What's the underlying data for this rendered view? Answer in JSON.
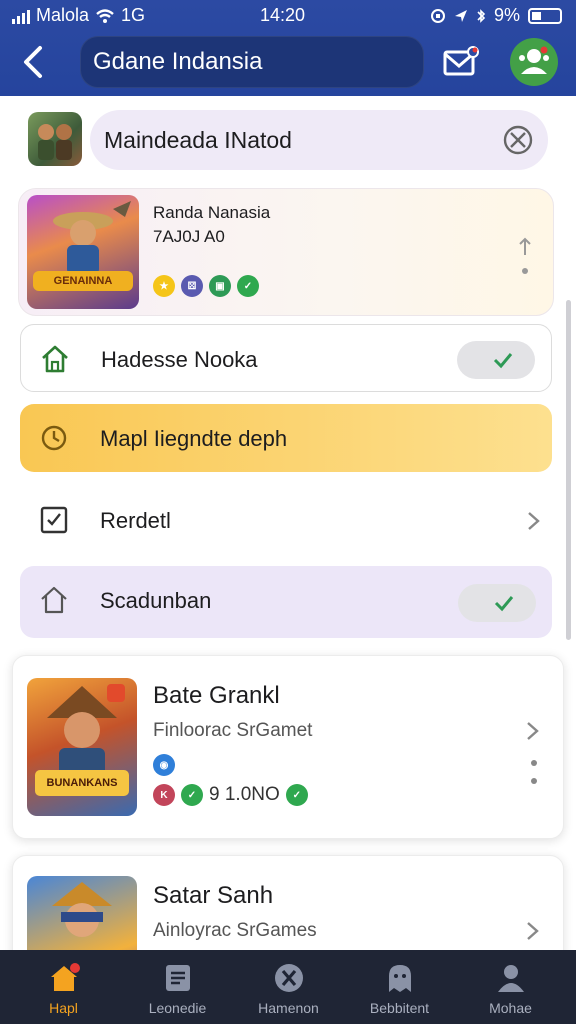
{
  "status_bar": {
    "carrier": "Malola",
    "network": "1G",
    "time": "14:20",
    "battery": "9%"
  },
  "header": {
    "search_text": "Gdane Indansia",
    "icons": [
      "back-arrow-icon",
      "mail-icon",
      "profile-icon"
    ]
  },
  "search_row": {
    "text": "Maindeada INatod",
    "clear_icon": "clear-icon"
  },
  "feature_card": {
    "line1": "Randa Nanasia",
    "line2": "7АJ0J A0",
    "image_title": "GENAINNA"
  },
  "settings": [
    {
      "label": "Hadesse Nooka",
      "icon": "home-icon",
      "control": "toggle",
      "on": true
    },
    {
      "label": "Mapl Iiegndte deph",
      "icon": "clock-icon",
      "control": "none",
      "on": false
    },
    {
      "label": "Rerdetl",
      "icon": "checkbox-icon",
      "control": "chevron",
      "on": false
    },
    {
      "label": "Scadunban",
      "icon": "house-icon",
      "control": "toggle",
      "on": true
    }
  ],
  "game_cards": [
    {
      "title": "Bate Grankl",
      "subtitle": "Finloorac SrGamet",
      "meta": "9 1.0NО",
      "image_title": "BUNANKANS"
    },
    {
      "title": "Satar Sanh",
      "subtitle": "Ainloyrac SrGames",
      "meta": "",
      "image_title": ""
    }
  ],
  "bottom_nav": [
    {
      "label": "Hapl",
      "icon": "home-icon",
      "active": true
    },
    {
      "label": "Leonedie",
      "icon": "list-icon",
      "active": false
    },
    {
      "label": "Hamenon",
      "icon": "x-circle-icon",
      "active": false
    },
    {
      "label": "Bebbitent",
      "icon": "ghost-icon",
      "active": false
    },
    {
      "label": "Mohae",
      "icon": "person-icon",
      "active": false
    }
  ],
  "colors": {
    "header_bg": "#2c4aa3",
    "accent_green": "#43a047",
    "highlight_yellow": "#fcd679",
    "highlight_purple": "#ece6f8",
    "nav_bg": "#1f2535",
    "nav_active": "#f4a320"
  }
}
